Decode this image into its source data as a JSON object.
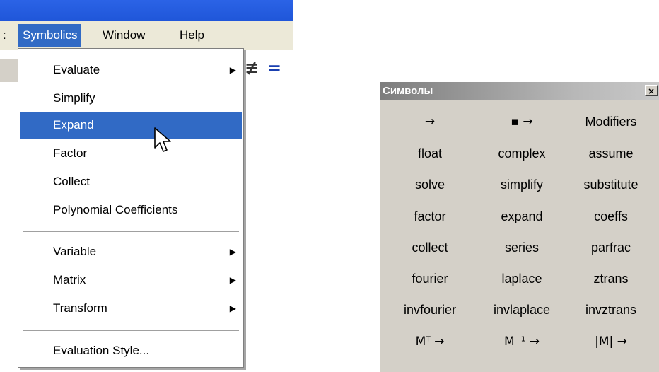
{
  "menubar": {
    "partial_left": ":",
    "items": [
      {
        "label": "Symbolics",
        "active": true
      },
      {
        "label": "Window",
        "active": false
      },
      {
        "label": "Help",
        "active": false
      }
    ],
    "toolbar_glyphs": [
      "≢",
      "="
    ]
  },
  "dropdown": {
    "items": [
      {
        "label": "Evaluate",
        "submenu": true
      },
      {
        "label": "Simplify",
        "submenu": false
      },
      {
        "label": "Expand",
        "submenu": false,
        "highlighted": true
      },
      {
        "label": "Factor",
        "submenu": false
      },
      {
        "label": "Collect",
        "submenu": false
      },
      {
        "label": "Polynomial Coefficients",
        "submenu": false
      },
      {
        "label": "Variable",
        "submenu": true
      },
      {
        "label": "Matrix",
        "submenu": true
      },
      {
        "label": "Transform",
        "submenu": true
      },
      {
        "label": "Evaluation Style...",
        "submenu": false
      }
    ],
    "arrow_glyph": "▶"
  },
  "palette": {
    "title": "Символы",
    "close_glyph": "×",
    "rows": [
      [
        "→",
        "▪ →",
        "Modifiers"
      ],
      [
        "float",
        "complex",
        "assume"
      ],
      [
        "solve",
        "simplify",
        "substitute"
      ],
      [
        "factor",
        "expand",
        "coeffs"
      ],
      [
        "collect",
        "series",
        "parfrac"
      ],
      [
        "fourier",
        "laplace",
        "ztrans"
      ],
      [
        "invfourier",
        "invlaplace",
        "invztrans"
      ],
      [
        "Mᵀ →",
        "M⁻¹ →",
        "|M| →"
      ]
    ]
  },
  "colors": {
    "menu_highlight": "#316ac5",
    "title_blue": "#1f56d9",
    "face": "#d4d0c8",
    "menubar": "#ece9d8"
  }
}
